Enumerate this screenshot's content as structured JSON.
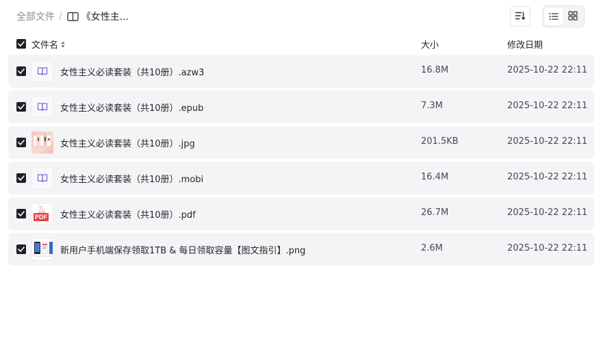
{
  "breadcrumb": {
    "root": "全部文件",
    "separator": "/",
    "current": "《女性主..."
  },
  "header": {
    "name": "文件名",
    "size": "大小",
    "date": "修改日期"
  },
  "files": [
    {
      "name": "女性主义必读套装（共10册）.azw3",
      "size": "16.8M",
      "date": "2025-10-22 22:11",
      "icon": "ebook-icon"
    },
    {
      "name": "女性主义必读套装（共10册）.epub",
      "size": "7.3M",
      "date": "2025-10-22 22:11",
      "icon": "ebook-icon"
    },
    {
      "name": "女性主义必读套装（共10册）.jpg",
      "size": "201.5KB",
      "date": "2025-10-22 22:11",
      "icon": "image-thumbnail"
    },
    {
      "name": "女性主义必读套装（共10册）.mobi",
      "size": "16.4M",
      "date": "2025-10-22 22:11",
      "icon": "ebook-icon"
    },
    {
      "name": "女性主义必读套装（共10册）.pdf",
      "size": "26.7M",
      "date": "2025-10-22 22:11",
      "icon": "pdf-icon",
      "icon_text": "PDF"
    },
    {
      "name": "新用户手机端保存领取1TB & 每日领取容量【图文指引】.png",
      "size": "2.6M",
      "date": "2025-10-22 22:11",
      "icon": "image-thumbnail"
    }
  ],
  "colors": {
    "row_bg": "#f3f4f6",
    "checkbox": "#1f2024",
    "ebook_accent": "#7b6fd6",
    "pdf_red": "#e64545"
  }
}
